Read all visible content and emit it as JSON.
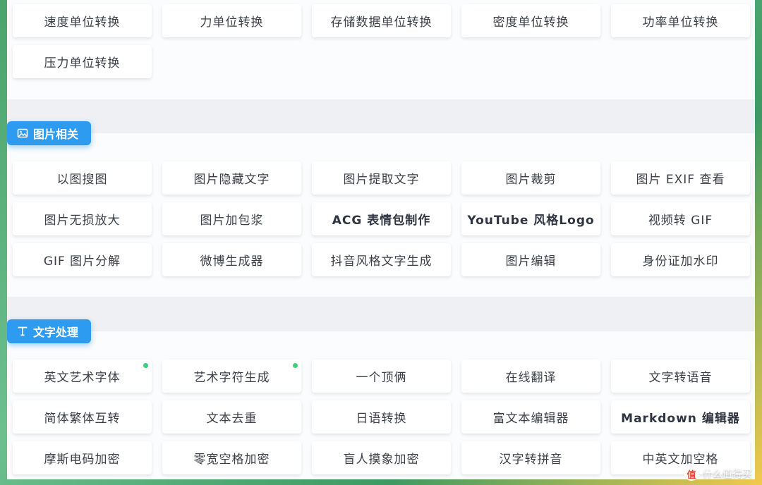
{
  "unit_section": {
    "tools": [
      {
        "label": "速度单位转换"
      },
      {
        "label": "力单位转换"
      },
      {
        "label": "存储数据单位转换"
      },
      {
        "label": "密度单位转换"
      },
      {
        "label": "功率单位转换"
      },
      {
        "label": "压力单位转换"
      }
    ]
  },
  "image_section": {
    "title": "图片相关",
    "icon": "image-icon",
    "tools": [
      {
        "label": "以图搜图"
      },
      {
        "label": "图片隐藏文字"
      },
      {
        "label": "图片提取文字"
      },
      {
        "label": "图片裁剪"
      },
      {
        "label": "图片 EXIF 查看"
      },
      {
        "label": "图片无损放大"
      },
      {
        "label": "图片加包浆"
      },
      {
        "label": "ACG 表情包制作"
      },
      {
        "label": "YouTube 风格Logo"
      },
      {
        "label": "视频转 GIF"
      },
      {
        "label": "GIF 图片分解"
      },
      {
        "label": "微博生成器"
      },
      {
        "label": "抖音风格文字生成"
      },
      {
        "label": "图片编辑"
      },
      {
        "label": "身份证加水印"
      }
    ]
  },
  "text_section": {
    "title": "文字处理",
    "icon": "text-icon",
    "tools": [
      {
        "label": "英文艺术字体"
      },
      {
        "label": "艺术字符生成"
      },
      {
        "label": "一个顶俩"
      },
      {
        "label": "在线翻译"
      },
      {
        "label": "文字转语音"
      },
      {
        "label": "简体繁体互转"
      },
      {
        "label": "文本去重"
      },
      {
        "label": "日语转换"
      },
      {
        "label": "富文本编辑器"
      },
      {
        "label": "Markdown 编辑器"
      },
      {
        "label": "摩斯电码加密"
      },
      {
        "label": "零宽空格加密"
      },
      {
        "label": "盲人摸象加密"
      },
      {
        "label": "汉字转拼音"
      },
      {
        "label": "中英文加空格"
      }
    ]
  },
  "watermark": {
    "text": "什么值得买",
    "mark": "值"
  },
  "colors": {
    "accent": "#2d9bf0",
    "new_dot": "#3ecf7a",
    "page_bg": "#eef0f3"
  }
}
